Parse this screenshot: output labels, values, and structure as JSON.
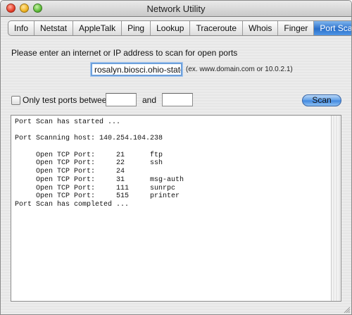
{
  "window": {
    "title": "Network Utility"
  },
  "tabs": [
    {
      "label": "Info",
      "active": false
    },
    {
      "label": "Netstat",
      "active": false
    },
    {
      "label": "AppleTalk",
      "active": false
    },
    {
      "label": "Ping",
      "active": false
    },
    {
      "label": "Lookup",
      "active": false
    },
    {
      "label": "Traceroute",
      "active": false
    },
    {
      "label": "Whois",
      "active": false
    },
    {
      "label": "Finger",
      "active": false
    },
    {
      "label": "Port Scan",
      "active": true
    }
  ],
  "portscan": {
    "prompt": "Please enter an internet or IP address to scan for open ports",
    "address_value": "rosalyn.biosci.ohio-state.e",
    "address_hint": "(ex. www.domain.com or 10.0.2.1)",
    "only_test_label": "Only test ports between",
    "only_test_checked": false,
    "port_from": "",
    "and_label": "and",
    "port_to": "",
    "scan_button": "Scan"
  },
  "output": {
    "lines": [
      "Port Scan has started ...",
      "",
      "Port Scanning host: 140.254.104.238",
      "",
      "     Open TCP Port:     21      ftp",
      "     Open TCP Port:     22      ssh",
      "     Open TCP Port:     24",
      "     Open TCP Port:     31      msg-auth",
      "     Open TCP Port:     111     sunrpc",
      "     Open TCP Port:     515     printer",
      "Port Scan has completed ..."
    ]
  },
  "colors": {
    "accent": "#3e86df",
    "tab_active": "#2a6fc9"
  }
}
